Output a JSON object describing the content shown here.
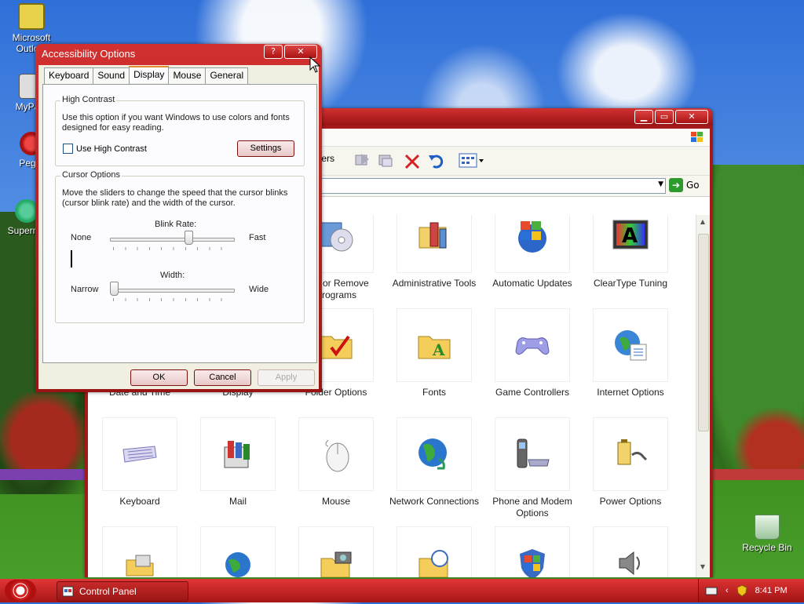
{
  "desktop": {
    "icons": [
      {
        "label": "Microsoft Outlo..."
      },
      {
        "label": "MyPa..."
      },
      {
        "label": "Peg..."
      },
      {
        "label": "Supern..."
      },
      {
        "label": "Recycle Bin"
      }
    ]
  },
  "control_panel": {
    "title": "Control Panel",
    "toolbar": {
      "folders_label": "lders"
    },
    "address": {
      "go_label": "Go"
    },
    "items": [
      {
        "label": "Add or Remove Programs",
        "icon": "add-remove-icon"
      },
      {
        "label": "Administrative Tools",
        "icon": "admin-tools-icon"
      },
      {
        "label": "Automatic Updates",
        "icon": "windows-update-icon"
      },
      {
        "label": "ClearType Tuning",
        "icon": "cleartype-icon"
      },
      {
        "label": "Date and Time",
        "icon": "clock-icon"
      },
      {
        "label": "Display",
        "icon": "display-icon"
      },
      {
        "label": "Folder Options",
        "icon": "folder-check-icon"
      },
      {
        "label": "Fonts",
        "icon": "fonts-folder-icon"
      },
      {
        "label": "Game Controllers",
        "icon": "gamepad-icon"
      },
      {
        "label": "Internet Options",
        "icon": "globe-doc-icon"
      },
      {
        "label": "Keyboard",
        "icon": "keyboard-icon"
      },
      {
        "label": "Mail",
        "icon": "mail-icon"
      },
      {
        "label": "Mouse",
        "icon": "mouse-icon"
      },
      {
        "label": "Network Connections",
        "icon": "network-globe-icon"
      },
      {
        "label": "Phone and Modem Options",
        "icon": "phone-modem-icon"
      },
      {
        "label": "Power Options",
        "icon": "battery-plug-icon"
      }
    ]
  },
  "dialog": {
    "title": "Accessibility Options",
    "tabs": [
      "Keyboard",
      "Sound",
      "Display",
      "Mouse",
      "General"
    ],
    "active_tab": "Display",
    "high_contrast": {
      "group_label": "High Contrast",
      "description": "Use this option if you want Windows to use colors and fonts designed for easy reading.",
      "checkbox_label": "Use High Contrast",
      "checked": false,
      "settings_button": "Settings"
    },
    "cursor_options": {
      "group_label": "Cursor Options",
      "description": "Move the sliders to change the speed that the cursor blinks (cursor blink rate) and the width of the cursor.",
      "blink_rate": {
        "label": "Blink Rate:",
        "min_label": "None",
        "max_label": "Fast",
        "value_fraction": 0.64
      },
      "width": {
        "label": "Width:",
        "min_label": "Narrow",
        "max_label": "Wide",
        "value_fraction": 0.0
      }
    },
    "buttons": {
      "ok": "OK",
      "cancel": "Cancel",
      "apply": "Apply"
    }
  },
  "taskbar": {
    "task_label": "Control Panel",
    "clock": "8:41 PM"
  },
  "colors": {
    "title_red": "#b81c1c",
    "taskbar_red": "#c52222"
  }
}
